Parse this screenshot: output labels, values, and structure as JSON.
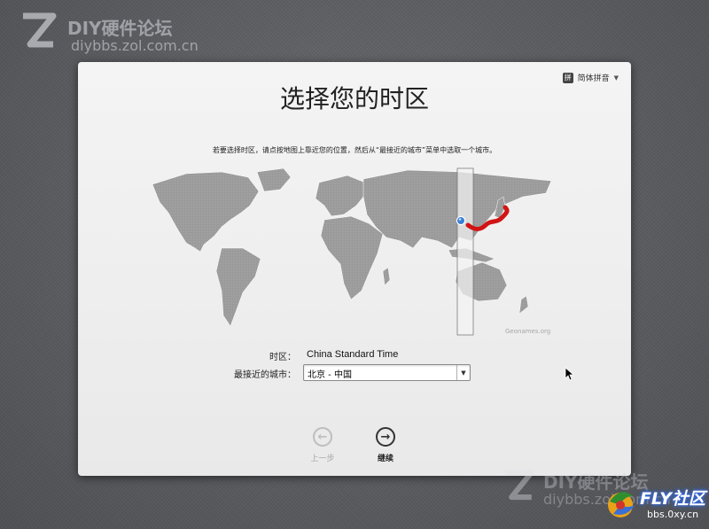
{
  "watermark": {
    "site_name": "DIY硬件论坛",
    "site_url": "diybbs.zol.com.cn",
    "brand_name": "FLY社区",
    "brand_url": "bbs.0xy.cn"
  },
  "panel": {
    "language_menu": "简体拼音",
    "language_icon": "拼",
    "title": "选择您的时区",
    "instruction": "若要选择时区，请点按地图上靠近您的位置，然后从“最接近的城市”菜单中选取一个城市。",
    "map_credit": "Geonames.org",
    "timezone_label": "时区：",
    "timezone_value": "China Standard Time",
    "city_label": "最接近的城市：",
    "city_value": "北京 - 中国",
    "back_label": "上一步",
    "continue_label": "继续"
  },
  "icons": {
    "back": "arrow-left-circle-icon",
    "continue": "arrow-right-circle-icon",
    "language": "input-method-icon",
    "dropdown": "chevron-down-icon",
    "location_pin": "location-pin-icon"
  },
  "colors": {
    "map_land": "#9a9a9a",
    "timezone_highlight": "#d21414",
    "selected_band": "#f4f4f4",
    "location_pin": "#3a7fd5"
  }
}
